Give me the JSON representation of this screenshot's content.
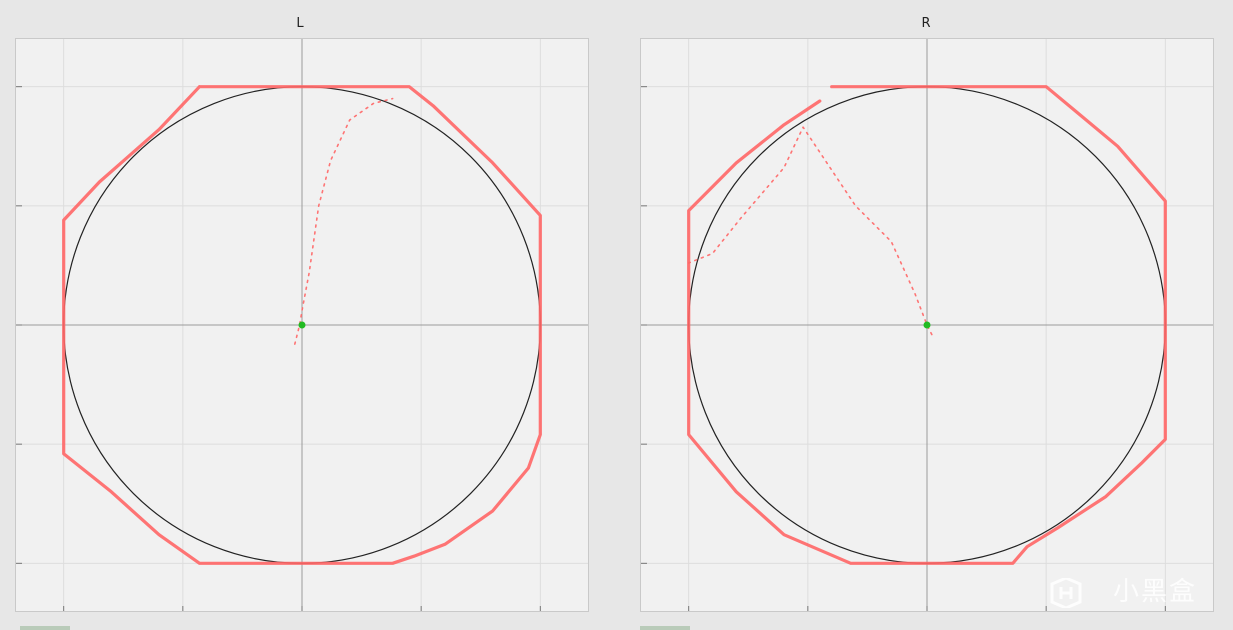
{
  "page": {
    "watermark_text": "小黑盒",
    "colors": {
      "trace": "#ff6666",
      "reference_circle": "#222222",
      "center_marker": "#22bb22",
      "background": "#f1f1f1"
    }
  },
  "chart_data": [
    {
      "type": "scatter",
      "title": "L",
      "xlim": [
        -1.2,
        1.2
      ],
      "ylim": [
        -1.2,
        1.2
      ],
      "grid": true,
      "reference_circle_radius": 1.0,
      "center_marker": [
        0,
        0
      ],
      "series": [
        {
          "values_xy": [
            [
              -0.43,
              1.0
            ],
            [
              0.45,
              1.0
            ],
            [
              0.55,
              0.92
            ],
            [
              0.8,
              0.68
            ],
            [
              1.0,
              0.46
            ],
            [
              1.0,
              -0.46
            ],
            [
              0.95,
              -0.6
            ],
            [
              0.8,
              -0.78
            ],
            [
              0.6,
              -0.92
            ],
            [
              0.47,
              -0.97
            ],
            [
              0.38,
              -1.0
            ],
            [
              -0.43,
              -1.0
            ],
            [
              -0.6,
              -0.88
            ],
            [
              -0.8,
              -0.7
            ],
            [
              -1.0,
              -0.54
            ],
            [
              -1.0,
              0.44
            ],
            [
              -0.85,
              0.6
            ],
            [
              -0.6,
              0.82
            ],
            [
              -0.43,
              1.0
            ]
          ]
        },
        {
          "values_xy": [
            [
              -0.03,
              -0.08
            ],
            [
              -0.01,
              0.0
            ],
            [
              0.0,
              0.06
            ],
            [
              0.03,
              0.22
            ],
            [
              0.07,
              0.5
            ],
            [
              0.12,
              0.69
            ],
            [
              0.2,
              0.86
            ],
            [
              0.3,
              0.93
            ],
            [
              0.38,
              0.95
            ]
          ]
        }
      ]
    },
    {
      "type": "scatter",
      "title": "R",
      "xlim": [
        -1.2,
        1.2
      ],
      "ylim": [
        -1.2,
        1.2
      ],
      "grid": true,
      "reference_circle_radius": 1.0,
      "center_marker": [
        0,
        0
      ],
      "series": [
        {
          "values_xy": [
            [
              -0.4,
              1.0
            ],
            [
              0.5,
              1.0
            ],
            [
              0.62,
              0.9
            ],
            [
              0.8,
              0.75
            ],
            [
              1.0,
              0.52
            ],
            [
              1.0,
              -0.48
            ],
            [
              0.9,
              -0.58
            ],
            [
              0.75,
              -0.72
            ],
            [
              0.55,
              -0.85
            ],
            [
              0.42,
              -0.93
            ],
            [
              0.36,
              -1.0
            ],
            [
              -0.32,
              -1.0
            ],
            [
              -0.6,
              -0.88
            ],
            [
              -0.8,
              -0.7
            ],
            [
              -1.0,
              -0.46
            ],
            [
              -1.0,
              0.48
            ],
            [
              -0.8,
              0.68
            ],
            [
              -0.6,
              0.84
            ],
            [
              -0.45,
              0.94
            ]
          ]
        },
        {
          "values_xy": [
            [
              0.02,
              -0.04
            ],
            [
              0.0,
              0.0
            ],
            [
              -0.05,
              0.13
            ],
            [
              -0.15,
              0.35
            ],
            [
              -0.3,
              0.5
            ],
            [
              -0.42,
              0.68
            ],
            [
              -0.52,
              0.83
            ],
            [
              -0.6,
              0.66
            ],
            [
              -0.78,
              0.45
            ],
            [
              -0.9,
              0.3
            ],
            [
              -1.0,
              0.26
            ]
          ]
        }
      ]
    }
  ]
}
